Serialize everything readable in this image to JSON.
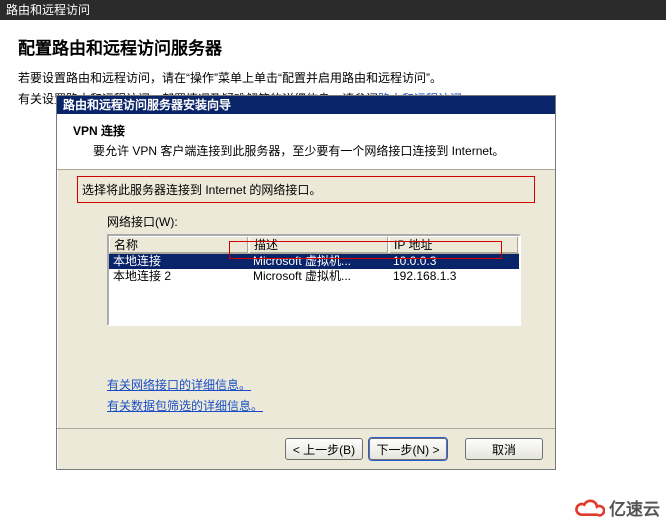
{
  "app": {
    "title": "路由和远程访问"
  },
  "page": {
    "heading": "配置路由和远程访问服务器",
    "line1_a": "若要设置路由和远程访问，请在“操作”菜单上单击“配置并启用路由和远程访问”。",
    "line2_a": "有关设置路由和远程访问、部署情况及疑难解答的详细信息，请参阅",
    "line2_link": "路由和远程访问",
    "line2_b": "。"
  },
  "wizard": {
    "title": "路由和远程访问服务器安装向导",
    "header_title": "VPN 连接",
    "header_desc": "要允许 VPN 客户端连接到此服务器，至少要有一个网络接口连接到 Internet。",
    "instruction": "选择将此服务器连接到 Internet 的网络接口。",
    "iface_label": "网络接口(W):",
    "columns": {
      "name": "名称",
      "desc": "描述",
      "ip": "IP 地址"
    },
    "rows": [
      {
        "name": "本地连接",
        "desc": "Microsoft 虚拟机...",
        "ip": "10.0.0.3",
        "selected": true
      },
      {
        "name": "本地连接 2",
        "desc": "Microsoft 虚拟机...",
        "ip": "192.168.1.3",
        "selected": false
      }
    ],
    "link1": "有关网络接口的详细信息。",
    "link2": "有关数据包筛选的详细信息。",
    "buttons": {
      "back": "< 上一步(B)",
      "next": "下一步(N) >",
      "cancel": "取消"
    }
  },
  "watermark": {
    "text": "亿速云"
  }
}
